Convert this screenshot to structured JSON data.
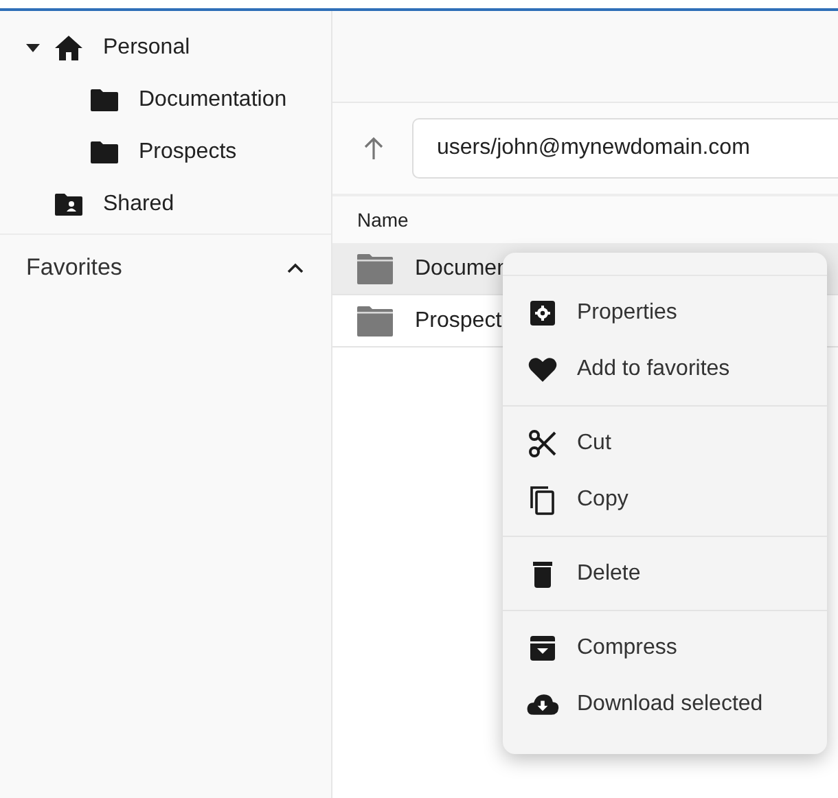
{
  "tree": [
    {
      "label": "Personal",
      "kind": "home",
      "expanded": true,
      "children": [
        {
          "label": "Documentation"
        },
        {
          "label": "Prospects"
        }
      ]
    },
    {
      "label": "Shared",
      "kind": "shared"
    }
  ],
  "favorites": {
    "label": "Favorites",
    "expanded": true
  },
  "address": {
    "value": "users/john@mynewdomain.com"
  },
  "table": {
    "columns": [
      "Name"
    ],
    "rows": [
      {
        "name": "Documen",
        "selected": true
      },
      {
        "name": "Prospect",
        "selected": false
      }
    ]
  },
  "context_menu": {
    "groups": [
      [
        {
          "label": "Properties",
          "kind": "properties"
        },
        {
          "label": "Add to favorites",
          "kind": "favorite"
        }
      ],
      [
        {
          "label": "Cut",
          "kind": "cut"
        },
        {
          "label": "Copy",
          "kind": "copy"
        }
      ],
      [
        {
          "label": "Delete",
          "kind": "delete"
        }
      ],
      [
        {
          "label": "Compress",
          "kind": "compress"
        },
        {
          "label": "Download selected",
          "kind": "download"
        }
      ]
    ]
  }
}
